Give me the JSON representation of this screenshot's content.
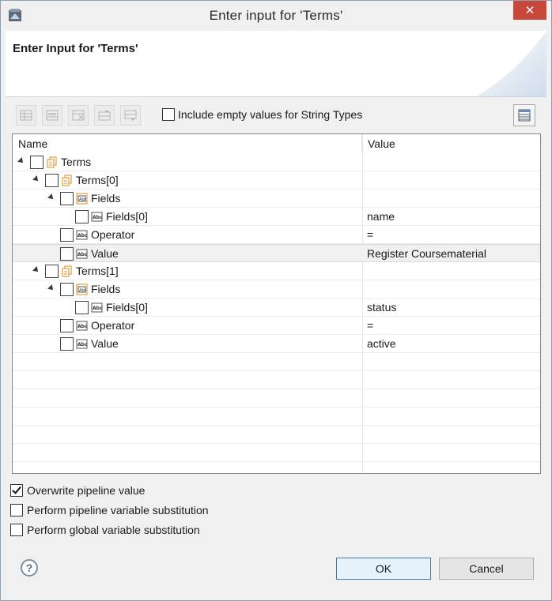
{
  "window": {
    "title": "Enter input for 'Terms'",
    "close_glyph": "✕"
  },
  "header": {
    "title": "Enter Input for 'Terms'"
  },
  "toolbar": {
    "include_empty_label": "Include empty values for String Types",
    "include_empty_checked": false,
    "buttons": [
      "add-row-icon",
      "insert-row-icon",
      "delete-row-icon",
      "move-up-icon",
      "move-down-icon"
    ]
  },
  "table": {
    "columns": {
      "name": "Name",
      "value": "Value"
    },
    "rows": [
      {
        "label": "Terms",
        "value": "",
        "icon": "document-list-icon",
        "expanded": true,
        "selected": false
      },
      {
        "label": "Terms[0]",
        "value": "",
        "icon": "document-list-icon",
        "expanded": true,
        "selected": false
      },
      {
        "label": "Fields",
        "value": "",
        "icon": "string-list-icon",
        "expanded": true,
        "selected": false
      },
      {
        "label": "Fields[0]",
        "value": "name",
        "icon": "string-icon",
        "expanded": false,
        "selected": false
      },
      {
        "label": "Operator",
        "value": "=",
        "icon": "string-icon",
        "expanded": false,
        "selected": false
      },
      {
        "label": "Value",
        "value": "Register Coursematerial",
        "icon": "string-icon",
        "expanded": false,
        "selected": true
      },
      {
        "label": "Terms[1]",
        "value": "",
        "icon": "document-list-icon",
        "expanded": true,
        "selected": false
      },
      {
        "label": "Fields",
        "value": "",
        "icon": "string-list-icon",
        "expanded": true,
        "selected": false
      },
      {
        "label": "Fields[0]",
        "value": "status",
        "icon": "string-icon",
        "expanded": false,
        "selected": false
      },
      {
        "label": "Operator",
        "value": "=",
        "icon": "string-icon",
        "expanded": false,
        "selected": false
      },
      {
        "label": "Value",
        "value": "active",
        "icon": "string-icon",
        "expanded": false,
        "selected": false
      }
    ]
  },
  "options": [
    {
      "label": "Overwrite pipeline value",
      "checked": true
    },
    {
      "label": "Perform pipeline variable substitution",
      "checked": false
    },
    {
      "label": "Perform global variable substitution",
      "checked": false
    }
  ],
  "footer": {
    "help_glyph": "?",
    "ok_label": "OK",
    "cancel_label": "Cancel"
  },
  "colors": {
    "close_button": "#c7473b",
    "default_button_border": "#3c7fb1",
    "icon_orange": "#d98b1f"
  }
}
